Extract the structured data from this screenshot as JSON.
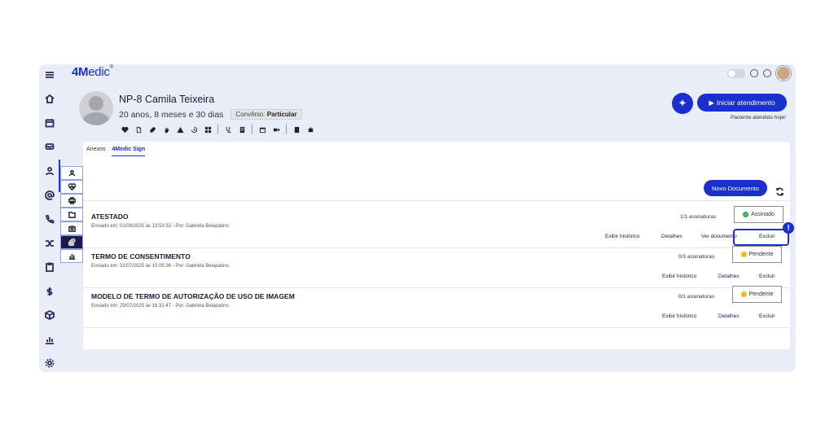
{
  "brand": {
    "logo_bold": "4M",
    "logo_rest": "edic",
    "logo_mark": "®"
  },
  "patient": {
    "name": "NP-8 Camila Teixeira",
    "age": "20 anos, 8 meses e 30 dias",
    "convenio_label": "Convênio:",
    "convenio_value": "Particular"
  },
  "header": {
    "start_label": "Iniciar atendimento",
    "attended_text": "Paciente atendido hoje!"
  },
  "tabs": {
    "anexos": "Anexos",
    "sign": "4Medic Sign"
  },
  "actions": {
    "new_document": "Novo Documento"
  },
  "documents": [
    {
      "title": "ATESTADO",
      "meta": "Enviado em: 01/08/2025 às 13:53:32 - Por: Gabriela Belapatino",
      "signatures": "1/1 assinaturas",
      "status": "Assinado",
      "status_color": "#2eaa4a",
      "history": "Exibir histórico",
      "details": "Detalhes",
      "view": "Ver documento",
      "delete": "Excluir"
    },
    {
      "title": "TERMO DE CONSENTIMENTO",
      "meta": "Enviado em: 31/07/2025 às 15:05:36 - Por: Gabriela Belapatino",
      "signatures": "0/3 assinaturas",
      "status": "Pendente",
      "status_color": "#f5b81c",
      "history": "Exibir histórico",
      "details": "Detalhes",
      "delete": "Excluir"
    },
    {
      "title": "MODELO DE TERMO DE AUTORIZAÇÃO DE USO DE IMAGEM",
      "meta": "Enviado em: 29/07/2025 às 16:31:47 - Por: Gabriela Belapatino",
      "signatures": "0/1 assinaturas",
      "status": "Pendente",
      "status_color": "#f5b81c",
      "history": "Exibir histórico",
      "details": "Detalhes",
      "delete": "Excluir"
    }
  ],
  "colors": {
    "accent": "#1a2fd0",
    "background": "#e9edf8",
    "sidebar_selected": "#1b1b4a"
  }
}
